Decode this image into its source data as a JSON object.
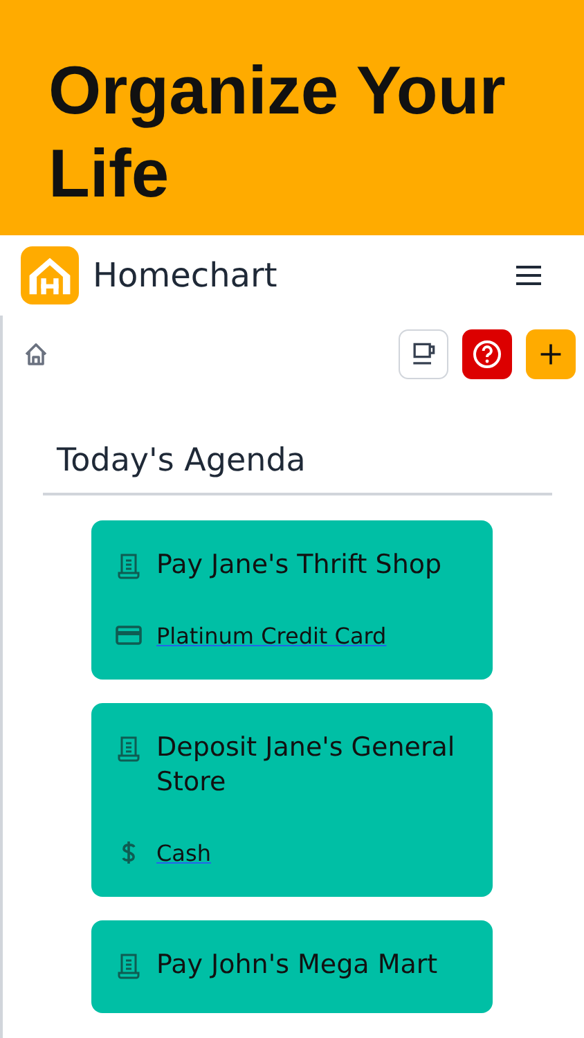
{
  "banner": {
    "headline": "Organize Your Life"
  },
  "header": {
    "app_name": "Homechart"
  },
  "agenda": {
    "title": "Today's Agenda",
    "items": [
      {
        "title": "Pay Jane's Thrift Shop",
        "account": {
          "kind": "card",
          "label": "Platinum Credit Card"
        }
      },
      {
        "title": "Deposit Jane's General Store",
        "account": {
          "kind": "cash",
          "label": "Cash"
        }
      },
      {
        "title": "Pay John's Mega Mart"
      }
    ]
  }
}
